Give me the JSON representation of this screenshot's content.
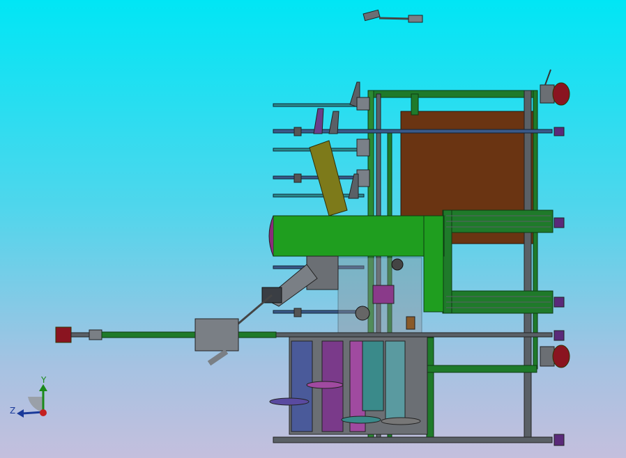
{
  "triad": {
    "x_label": "",
    "y_label": "Y",
    "z_label": "Z"
  },
  "colors": {
    "bg_top": "#00e6f5",
    "bg_bottom": "#c4bfdd",
    "frame_green": "#1f7a2a",
    "frame_gray": "#5a6066",
    "panel_brown": "#6a3412",
    "motor_green": "#1f9e1f",
    "hopper_olive": "#7d7a1a",
    "wheel_red": "#8a1420"
  }
}
